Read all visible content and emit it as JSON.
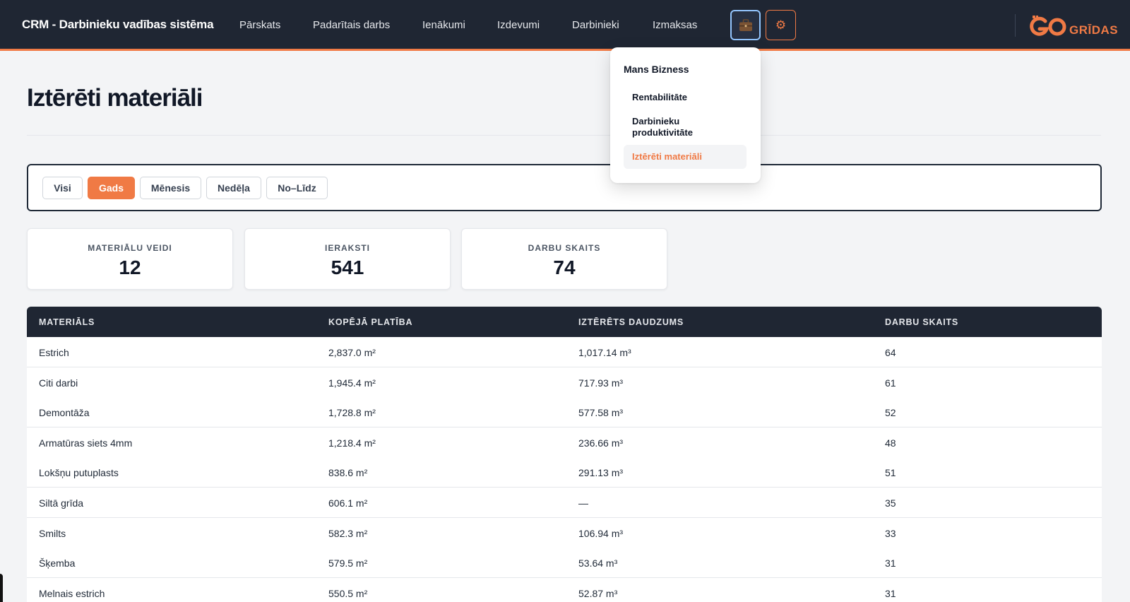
{
  "header": {
    "brand": "CRM - Darbinieku vadības sistēma",
    "nav": [
      "Pārskats",
      "Padarītais darbs",
      "Ienākumi",
      "Izdevumi",
      "Darbinieki",
      "Izmaksas"
    ],
    "briefcase_icon": "briefcase-icon",
    "gear_icon": "gear-icon",
    "gear_glyph": "⚙",
    "logo_text": "GRĪDAS",
    "accent_color": "#f07a45"
  },
  "dropdown": {
    "heading": "Mans Bizness",
    "items": [
      "Rentabilitāte",
      "Darbinieku produktivitāte",
      "Iztērēti materiāli"
    ],
    "active_index": 2
  },
  "page": {
    "title": "Iztērēti materiāli"
  },
  "filters": {
    "options": [
      "Visi",
      "Gads",
      "Mēnesis",
      "Nedēļa",
      "No–Līdz"
    ],
    "active": "Gads"
  },
  "stats": [
    {
      "label": "MATERIĀLU VEIDI",
      "value": "12"
    },
    {
      "label": "IERAKSTI",
      "value": "541"
    },
    {
      "label": "DARBU SKAITS",
      "value": "74"
    }
  ],
  "table": {
    "headers": [
      "MATERIĀLS",
      "KOPĒJĀ PLATĪBA",
      "IZTĒRĒTS DAUDZUMS",
      "DARBU SKAITS"
    ],
    "rows": [
      [
        "Estrich",
        "2,837.0 m²",
        "1,017.14 m³",
        "64"
      ],
      [
        "Citi darbi",
        "1,945.4 m²",
        "717.93 m³",
        "61"
      ],
      [
        "Demontāža",
        "1,728.8 m²",
        "577.58 m³",
        "52"
      ],
      [
        "Armatūras siets 4mm",
        "1,218.4 m²",
        "236.66 m³",
        "48"
      ],
      [
        "Lokšņu putuplasts",
        "838.6 m²",
        "291.13 m³",
        "51"
      ],
      [
        "Siltā grīda",
        "606.1 m²",
        "—",
        "35"
      ],
      [
        "Smilts",
        "582.3 m²",
        "106.94 m³",
        "33"
      ],
      [
        "Šķemba",
        "579.5 m²",
        "53.64 m³",
        "31"
      ],
      [
        "Melnais estrich",
        "550.5 m²",
        "52.87 m³",
        "31"
      ]
    ]
  }
}
